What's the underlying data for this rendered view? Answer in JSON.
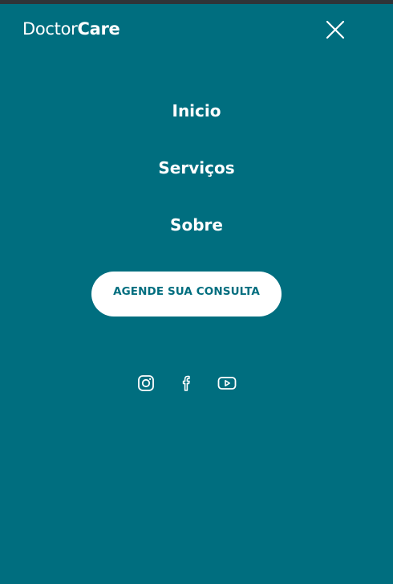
{
  "header": {
    "logo_light": "Doctor",
    "logo_bold": "Care",
    "close_icon": "close-icon"
  },
  "menu": {
    "items": [
      {
        "label": "Inicio"
      },
      {
        "label": "Serviços"
      },
      {
        "label": "Sobre"
      }
    ],
    "cta_label": "AGENDE SUA CONSULTA"
  },
  "social": {
    "icons": [
      "instagram-icon",
      "facebook-icon",
      "youtube-icon"
    ]
  },
  "colors": {
    "background": "#006e7f",
    "foreground": "#ffffff",
    "button_text": "#006e7f",
    "top_strip": "#2f3438"
  }
}
